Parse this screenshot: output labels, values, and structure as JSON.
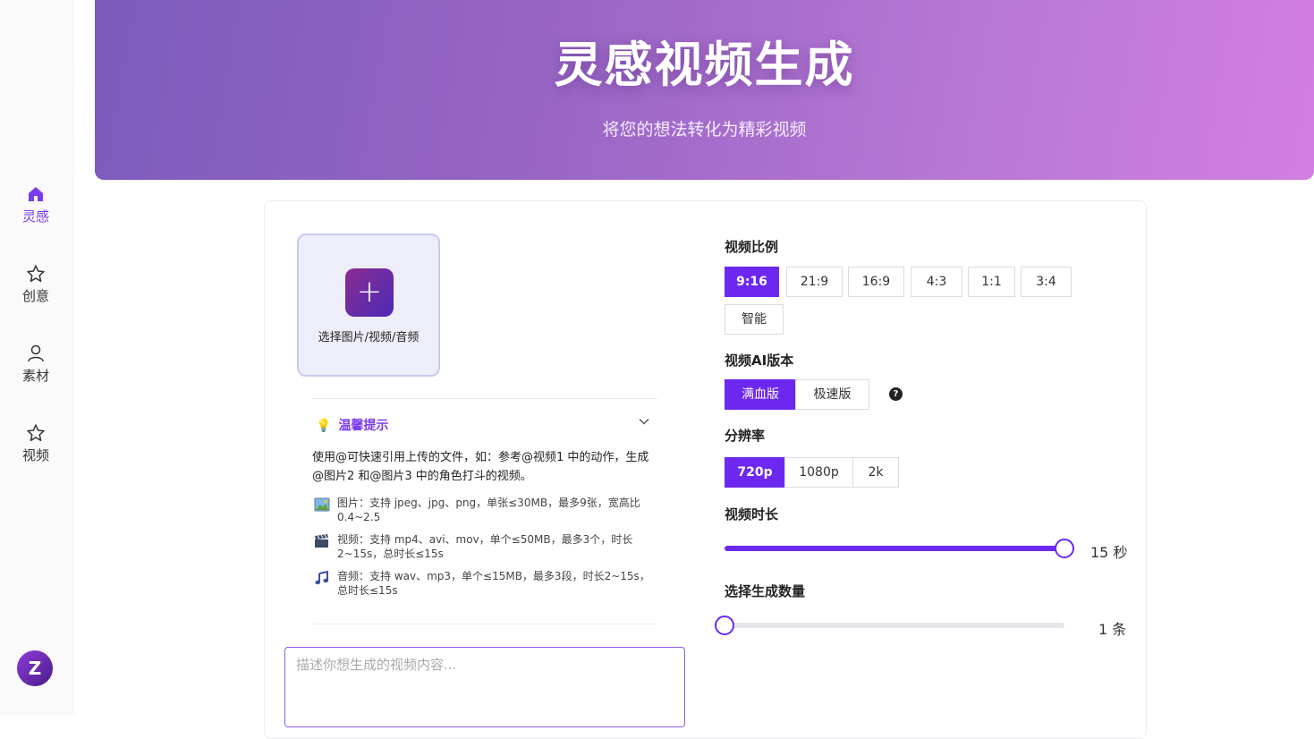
{
  "sidebar": {
    "items": [
      {
        "label": "灵感",
        "icon": "home-icon",
        "active": true
      },
      {
        "label": "创意",
        "icon": "star-icon"
      },
      {
        "label": "素材",
        "icon": "user-icon"
      },
      {
        "label": "视频",
        "icon": "star-icon"
      }
    ],
    "avatar": "Z"
  },
  "hero": {
    "title": "灵感视频生成",
    "subtitle": "将您的想法转化为精彩视频"
  },
  "upload": {
    "label": "选择图片/视频/音频",
    "icon": "plus-icon"
  },
  "tips": {
    "title": "温馨提示",
    "intro": "使用@可快速引用上传的文件，如：参考@视频1 中的动作，生成@图片2 和@图片3 中的角色打斗的视频。",
    "items": [
      {
        "icon": "image-icon",
        "text": "图片：支持 jpeg、jpg、png，单张≤30MB，最多9张，宽高比0.4~2.5"
      },
      {
        "icon": "video-icon",
        "text": "视频：支持 mp4、avi、mov，单个≤50MB，最多3个，时长2~15s，总时长≤15s"
      },
      {
        "icon": "music-icon",
        "text": "音频：支持 wav、mp3，单个≤15MB，最多3段，时长2~15s，总时长≤15s"
      }
    ]
  },
  "prompt": {
    "placeholder": "描述你想生成的视频内容...",
    "value": ""
  },
  "settings": {
    "ratio": {
      "title": "视频比例",
      "options": [
        "9:16",
        "21:9",
        "16:9",
        "4:3",
        "1:1",
        "3:4",
        "智能"
      ],
      "selected": "9:16"
    },
    "version": {
      "title": "视频AI版本",
      "options": [
        "满血版",
        "极速版"
      ],
      "selected": "满血版",
      "help": "?"
    },
    "resolution": {
      "title": "分辨率",
      "options": [
        "720p",
        "1080p",
        "2k"
      ],
      "selected": "720p"
    },
    "duration": {
      "title": "视频时长",
      "value_label": "15 秒",
      "fraction": 1.0
    },
    "count": {
      "title": "选择生成数量",
      "value_label": "1 条",
      "fraction": 0.0
    }
  },
  "colors": {
    "accent": "#6d28f0",
    "hero_start": "#7c5bbd",
    "hero_end": "#d27fe2"
  }
}
